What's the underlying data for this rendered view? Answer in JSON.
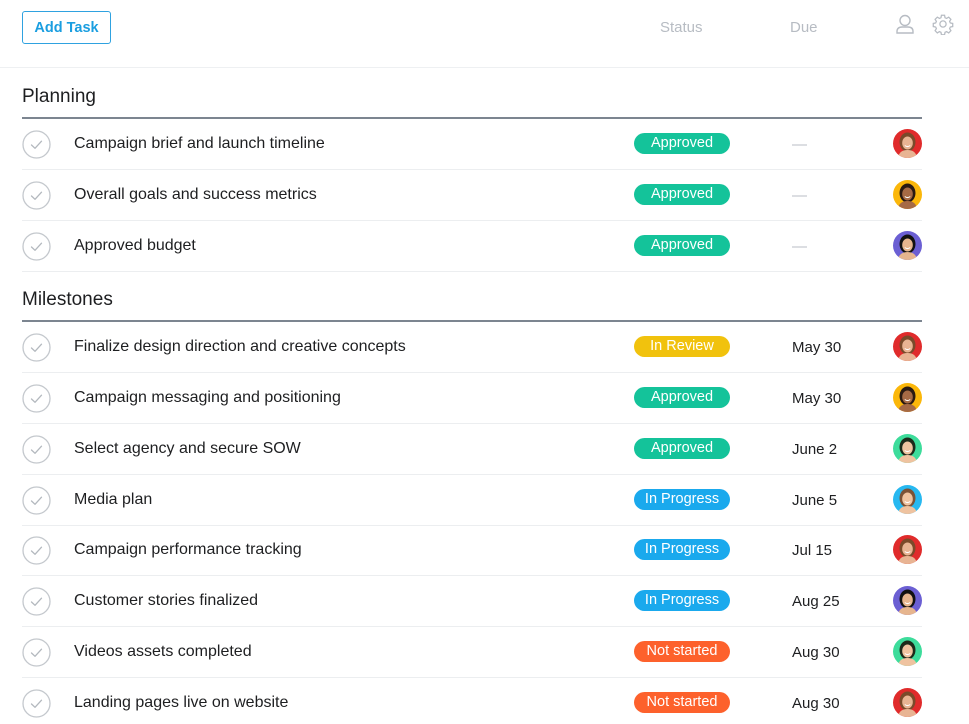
{
  "toolbar": {
    "add_task_label": "Add Task",
    "column_status": "Status",
    "column_due": "Due",
    "user_icon": "person-outline-icon",
    "settings_icon": "gear-icon"
  },
  "colors": {
    "accent": "#1a9ee0",
    "approved": "#14c39a",
    "in_review": "#f1c20d",
    "in_progress": "#1aa9ed",
    "not_started": "#fd612c"
  },
  "sections": [
    {
      "title": "Planning",
      "tasks": [
        {
          "name": "Campaign brief and launch timeline",
          "status": "Approved",
          "status_key": "approved",
          "due": "—",
          "avatar": {
            "bg": "#e02b2b",
            "skin": "#e8b493",
            "hair": "#7a4a2a"
          }
        },
        {
          "name": "Overall goals and success metrics",
          "status": "Approved",
          "status_key": "approved",
          "due": "—",
          "avatar": {
            "bg": "#fbb70a",
            "skin": "#a66a45",
            "hair": "#2a1a12"
          }
        },
        {
          "name": "Approved budget",
          "status": "Approved",
          "status_key": "approved",
          "due": "—",
          "avatar": {
            "bg": "#6b5fd3",
            "skin": "#e6b58e",
            "hair": "#111111"
          }
        }
      ]
    },
    {
      "title": "Milestones",
      "tasks": [
        {
          "name": "Finalize design direction and creative concepts",
          "status": "In Review",
          "status_key": "in_review",
          "due": "May 30",
          "avatar": {
            "bg": "#e02b2b",
            "skin": "#e8b493",
            "hair": "#7a4a2a"
          }
        },
        {
          "name": "Campaign messaging and positioning",
          "status": "Approved",
          "status_key": "approved",
          "due": "May 30",
          "avatar": {
            "bg": "#fbb70a",
            "skin": "#a66a45",
            "hair": "#2a1a12"
          }
        },
        {
          "name": "Select agency and secure SOW",
          "status": "Approved",
          "status_key": "approved",
          "due": "June 2",
          "avatar": {
            "bg": "#3ddc9b",
            "skin": "#efc3a0",
            "hair": "#1c2a1a"
          }
        },
        {
          "name": "Media plan",
          "status": "In Progress",
          "status_key": "in_progress",
          "due": "June 5",
          "avatar": {
            "bg": "#27b8f0",
            "skin": "#efc3a0",
            "hair": "#7b5236"
          }
        },
        {
          "name": "Campaign performance tracking",
          "status": "In Progress",
          "status_key": "in_progress",
          "due": "Jul 15",
          "avatar": {
            "bg": "#e02b2b",
            "skin": "#e8b493",
            "hair": "#7a4a2a"
          }
        },
        {
          "name": "Customer stories finalized",
          "status": "In Progress",
          "status_key": "in_progress",
          "due": "Aug 25",
          "avatar": {
            "bg": "#6b5fd3",
            "skin": "#e6b58e",
            "hair": "#111111"
          }
        },
        {
          "name": "Videos assets completed",
          "status": "Not started",
          "status_key": "not_started",
          "due": "Aug 30",
          "avatar": {
            "bg": "#3ddc9b",
            "skin": "#efc3a0",
            "hair": "#1c2a1a"
          }
        },
        {
          "name": "Landing pages live on website",
          "status": "Not started",
          "status_key": "not_started",
          "due": "Aug 30",
          "avatar": {
            "bg": "#e02b2b",
            "skin": "#e8b493",
            "hair": "#7a4a2a"
          }
        }
      ]
    }
  ]
}
